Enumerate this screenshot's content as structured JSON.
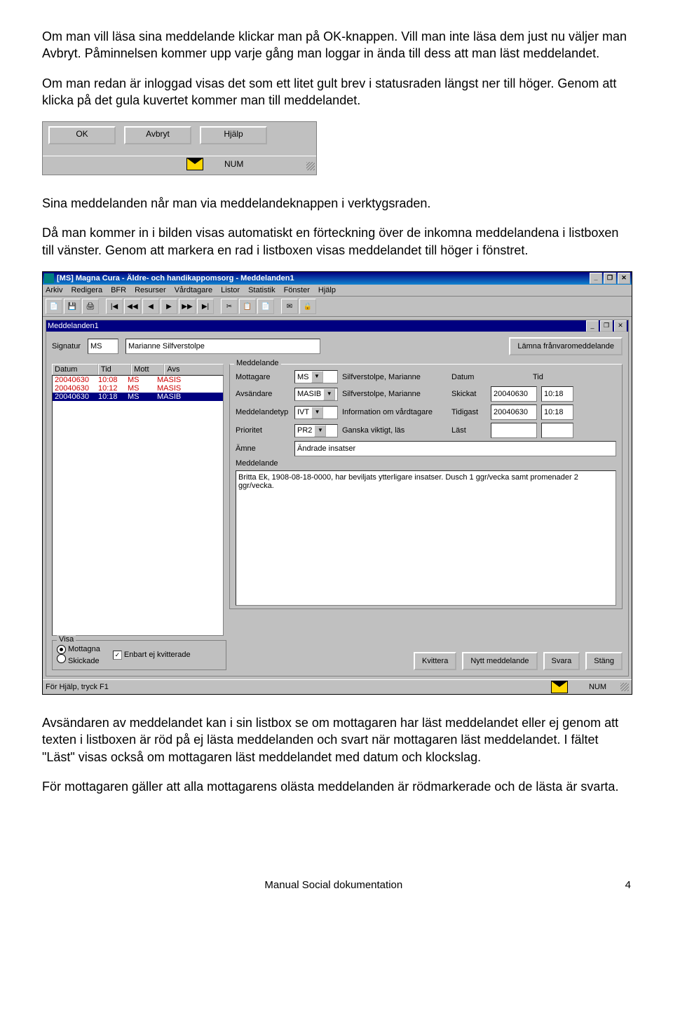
{
  "para1": "Om man vill läsa sina meddelande klickar man på OK-knappen. Vill man inte läsa dem just nu väljer man Avbryt. Påminnelsen kommer upp varje gång man loggar in ända till dess att man läst meddelandet.",
  "para2": "Om man redan är inloggad visas det som ett litet gult brev i statusraden längst ner till höger. Genom att klicka på det gula kuvertet kommer man till meddelandet.",
  "sb": {
    "ok": "OK",
    "avbryt": "Avbryt",
    "hjalp": "Hjälp",
    "num": "NUM"
  },
  "para3": "Sina meddelanden når man via meddelandeknappen i verktygsraden.",
  "para4": "Då man kommer in i bilden visas automatiskt en förteckning över de inkomna meddelandena i listboxen till vänster. Genom att markera en rad i listboxen visas meddelandet till höger i fönstret.",
  "app": {
    "title": "[MS] Magna Cura - Äldre- och handikappomsorg - Meddelanden1",
    "menu": [
      "Arkiv",
      "Redigera",
      "BFR",
      "Resurser",
      "Vårdtagare",
      "Listor",
      "Statistik",
      "Fönster",
      "Hjälp"
    ],
    "childtitle": "Meddelanden1",
    "sig_lbl": "Signatur",
    "sig_code": "MS",
    "sig_name": "Marianne Silfverstolpe",
    "away_btn": "Lämna frånvaromeddelande",
    "listhdr": {
      "datum": "Datum",
      "tid": "Tid",
      "mott": "Mott",
      "avs": "Avs"
    },
    "rows": [
      {
        "d": "20040630",
        "t": "10:08",
        "m": "MS",
        "a": "MASIS"
      },
      {
        "d": "20040630",
        "t": "10:12",
        "m": "MS",
        "a": "MASIS"
      },
      {
        "d": "20040630",
        "t": "10:18",
        "m": "MS",
        "a": "MASIB"
      }
    ],
    "detail": {
      "legend": "Meddelande",
      "mott_l": "Mottagare",
      "mott_c": "MS",
      "mott_n": "Silfverstolpe, Marianne",
      "datum_l": "Datum",
      "tid_l": "Tid",
      "avs_l": "Avsändare",
      "avs_c": "MASIB",
      "avs_n": "Silfverstolpe, Marianne",
      "skickat_l": "Skickat",
      "skickat_d": "20040630",
      "skickat_t": "10:18",
      "typ_l": "Meddelandetyp",
      "typ_c": "IVT",
      "typ_n": "Information om vårdtagare",
      "tidigast_l": "Tidigast",
      "tidigast_d": "20040630",
      "tidigast_t": "10:18",
      "prio_l": "Prioritet",
      "prio_c": "PR2",
      "prio_n": "Ganska viktigt, läs",
      "last_l": "Läst",
      "amne_l": "Ämne",
      "amne_v": "Ändrade insatser",
      "msg_l": "Meddelande",
      "msg_v": "Britta Ek, 1908-08-18-0000, har beviljats ytterligare insatser. Dusch 1 ggr/vecka samt promenader 2 ggr/vecka."
    },
    "visa": {
      "legend": "Visa",
      "mottagna": "Mottagna",
      "skickade": "Skickade",
      "enbart": "Enbart ej kvitterade"
    },
    "btns": {
      "kvittera": "Kvittera",
      "nytt": "Nytt meddelande",
      "svara": "Svara",
      "stang": "Stäng"
    },
    "status": "För Hjälp, tryck F1",
    "num": "NUM"
  },
  "para5": "Avsändaren av meddelandet kan i sin listbox se om mottagaren har läst meddelandet eller ej genom att texten i listboxen är röd på ej lästa meddelanden och svart när mottagaren läst meddelandet. I fältet \"Läst\" visas också om mottagaren läst meddelandet med datum och klockslag.",
  "para6": "För mottagaren gäller att alla mottagarens olästa meddelanden är rödmarkerade och de lästa är svarta.",
  "footer_l": "Manual Social dokumentation",
  "footer_r": "4"
}
